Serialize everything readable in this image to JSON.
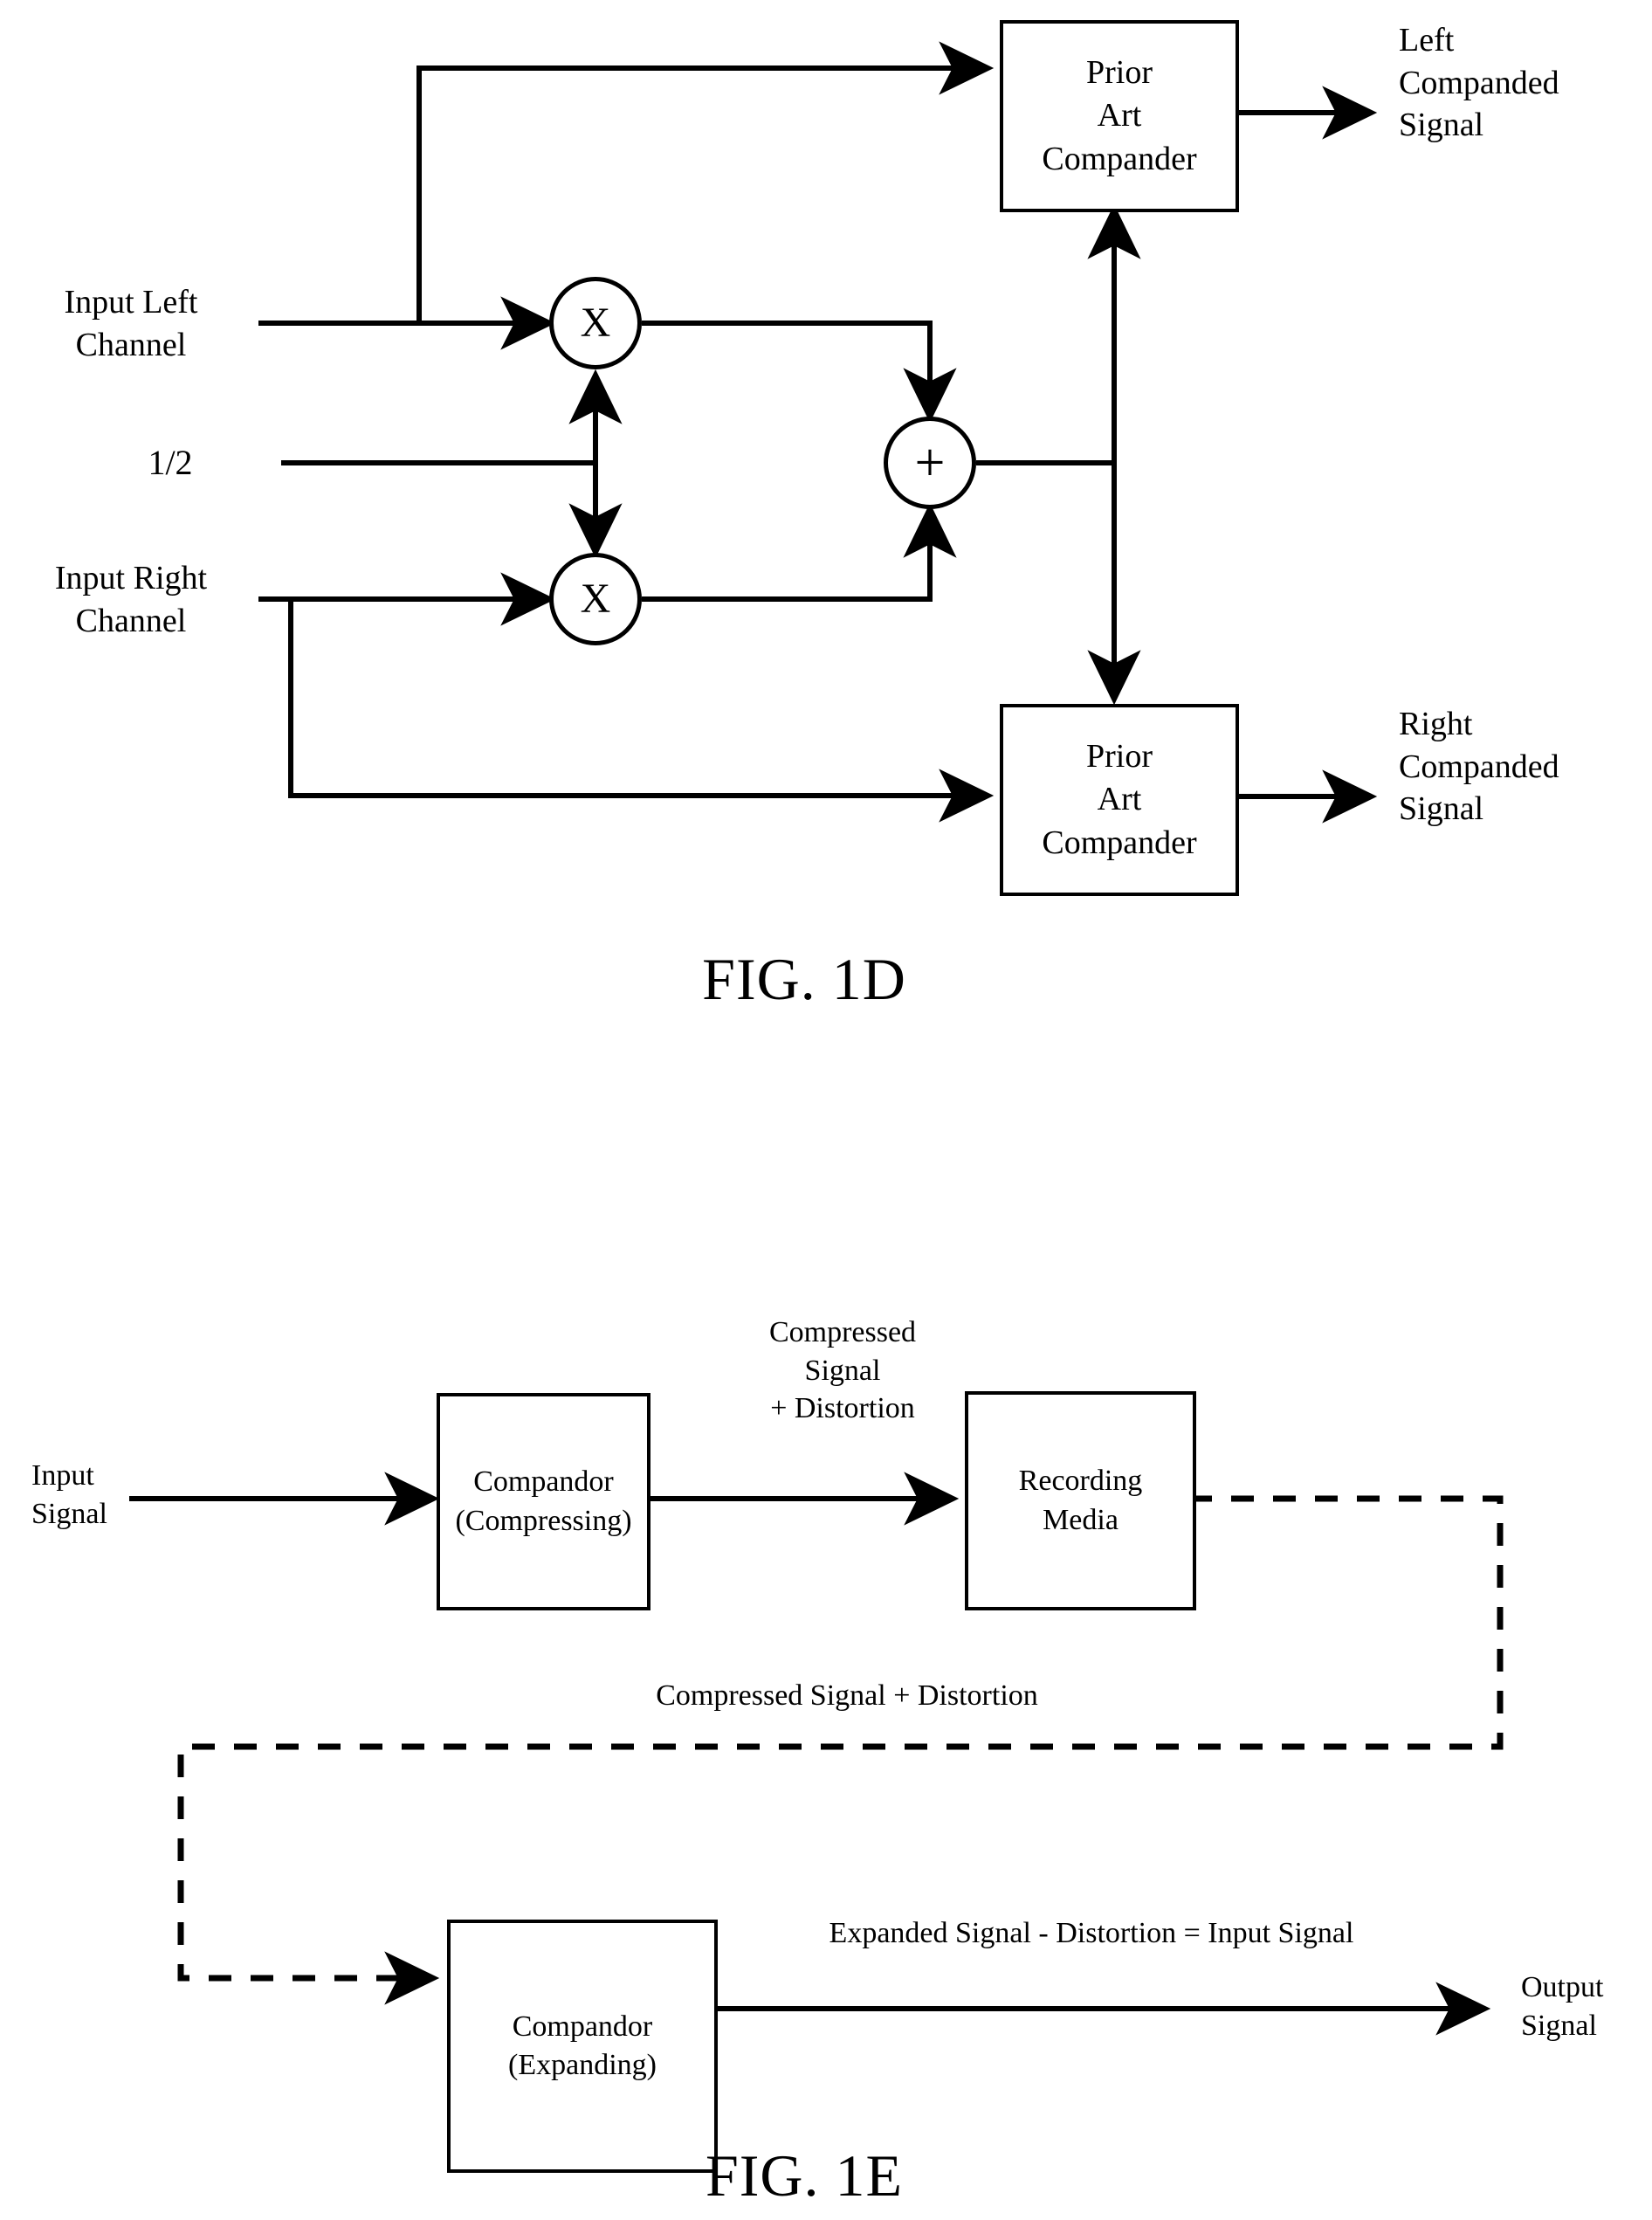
{
  "figures": [
    {
      "id": "fig-1d",
      "title": "FIG. 1D",
      "boxes": [
        {
          "name": "prior-art-compander-left",
          "lines": [
            "Prior",
            "Art",
            "Compander"
          ]
        },
        {
          "name": "prior-art-compander-right",
          "lines": [
            "Prior",
            "Art",
            "Compander"
          ]
        }
      ],
      "nodes": [
        {
          "name": "multiplier-left",
          "glyph": "X"
        },
        {
          "name": "multiplier-right",
          "glyph": "X"
        },
        {
          "name": "summer",
          "glyph": "+"
        }
      ],
      "labels": {
        "input_left": "Input Left\nChannel",
        "gain": "1/2",
        "input_right": "Input Right\nChannel",
        "output_left": "Left\nCompanded\nSignal",
        "output_right": "Right\nCompanded\nSignal"
      }
    },
    {
      "id": "fig-1e",
      "title": "FIG. 1E",
      "boxes": [
        {
          "name": "compandor-compressing",
          "lines": [
            "Compandor",
            "(Compressing)"
          ]
        },
        {
          "name": "recording-media",
          "lines": [
            "Recording",
            "Media"
          ]
        },
        {
          "name": "compandor-expanding",
          "lines": [
            "Compandor",
            "(Expanding)"
          ]
        }
      ],
      "labels": {
        "input_signal": "Input\nSignal",
        "compressed_signal_distortion": "Compressed\nSignal\n+ Distortion",
        "feedback_path": "Compressed Signal + Distortion",
        "expanded_signal": "Expanded Signal - Distortion = Input Signal",
        "output_signal": "Output\nSignal"
      }
    }
  ],
  "colors": {
    "ink": "#000000",
    "paper": "#ffffff"
  }
}
